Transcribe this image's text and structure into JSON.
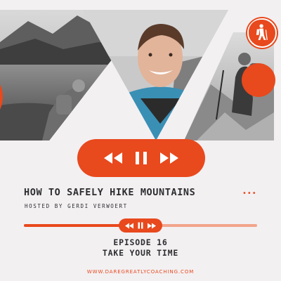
{
  "colors": {
    "accent": "#e8491d",
    "accent_light": "#f2a48a",
    "background": "#f3f0f2",
    "text": "#2d2d2f"
  },
  "player": {
    "rewind_icon": "rewind-icon",
    "pause_icon": "pause-icon",
    "forward_icon": "fast-forward-icon",
    "progress": 0.45
  },
  "podcast": {
    "title": "HOW TO SAFELY HIKE MOUNTAINS",
    "host": "HOSTED BY GERDI VERWOERT",
    "more_label": "•••",
    "episode_number": "EPISODE 16",
    "episode_title": "TAKE YOUR TIME",
    "website": "WWW.DAREGREATLYCOACHING.COM"
  }
}
